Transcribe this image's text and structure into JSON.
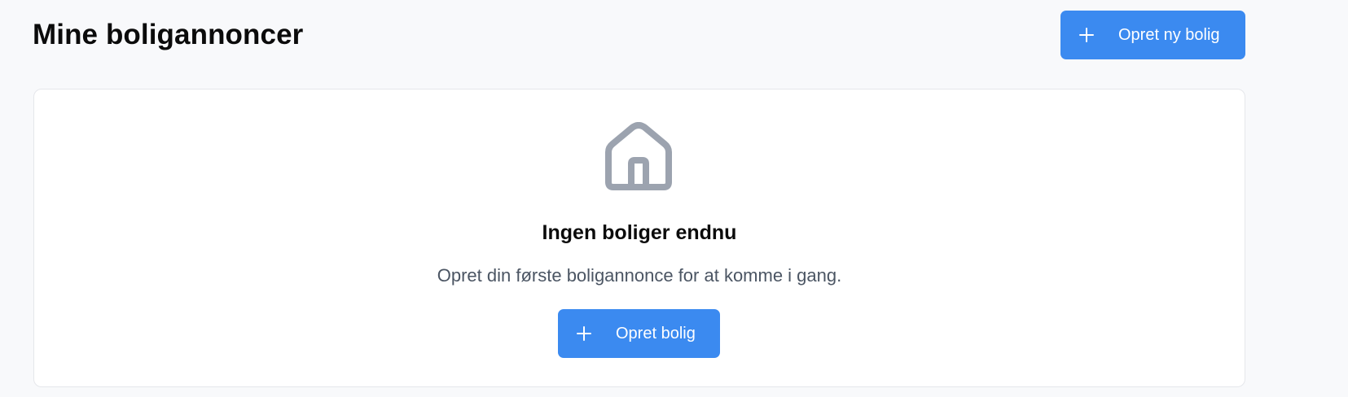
{
  "header": {
    "title": "Mine boligannoncer",
    "create_button_label": "Opret ny bolig"
  },
  "empty_state": {
    "icon": "house-icon",
    "title": "Ingen boliger endnu",
    "description": "Opret din første boligannonce for at komme i gang.",
    "create_button_label": "Opret bolig"
  },
  "colors": {
    "accent": "#3b8af0",
    "background": "#f8f9fb",
    "card": "#ffffff",
    "icon_gray": "#9ca3af",
    "muted_text": "#4b5563"
  }
}
